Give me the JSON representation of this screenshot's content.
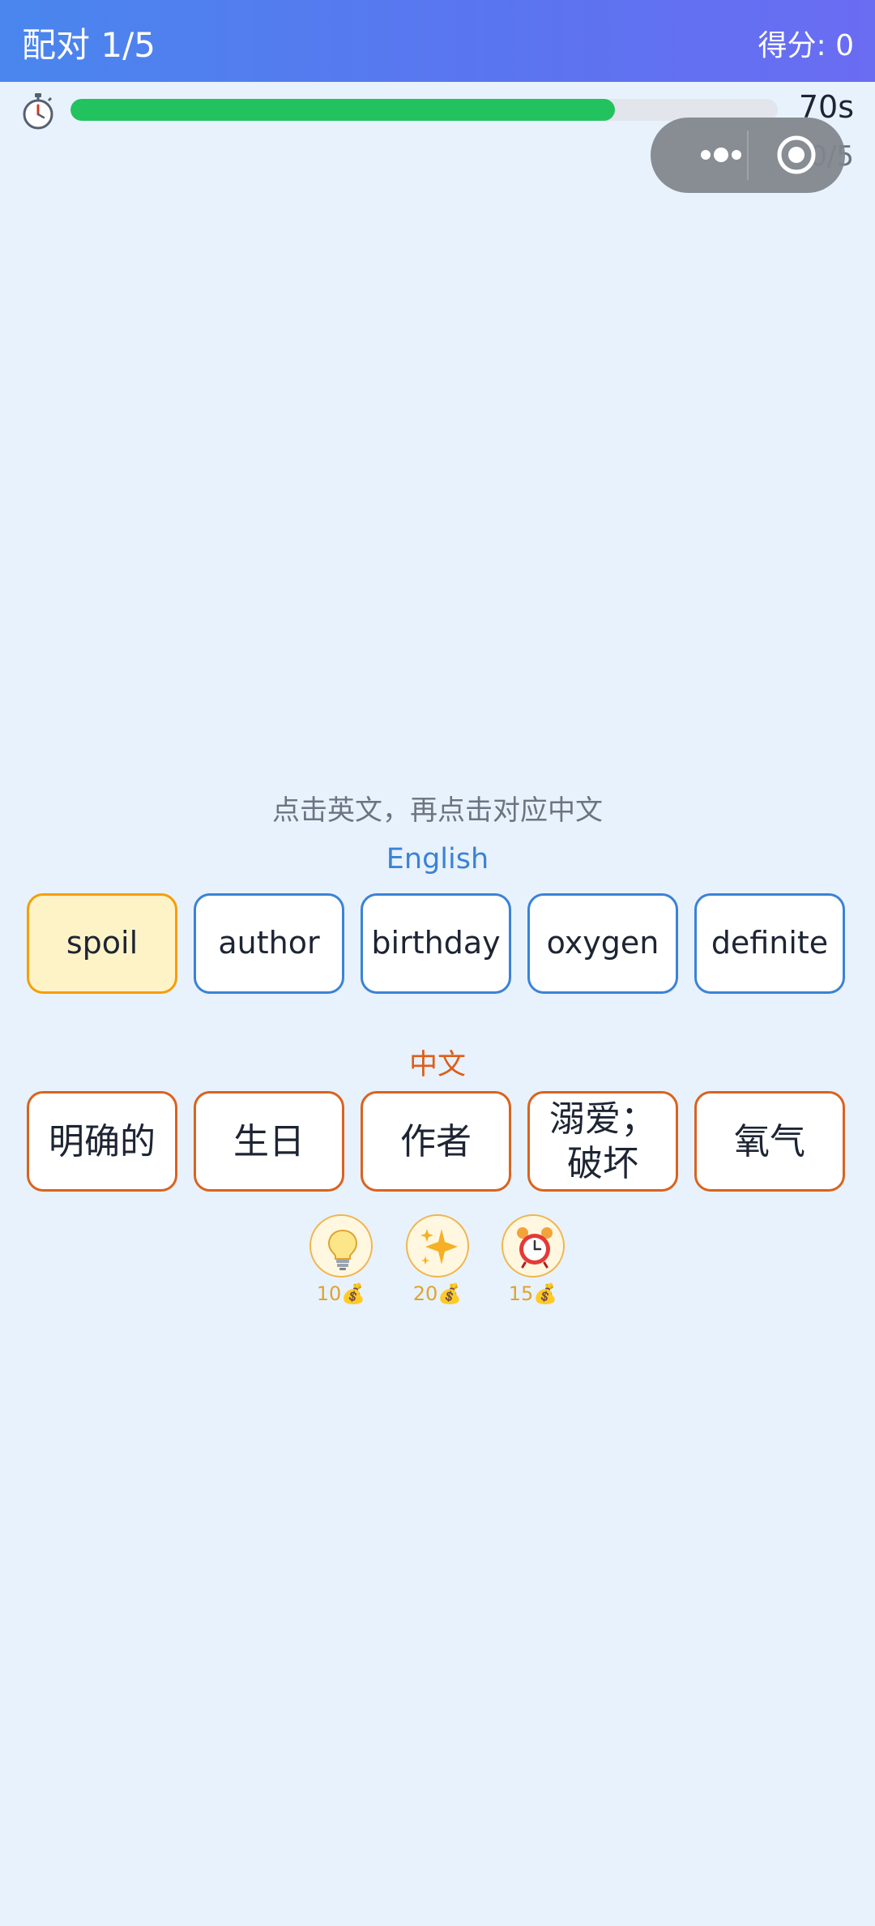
{
  "header": {
    "title": "配对 1/5",
    "score": "得分: 0"
  },
  "timer": {
    "value": "70s",
    "progress_fraction": 0.77,
    "icon": "stopwatch-icon"
  },
  "match_count": "0/5",
  "capsule": {
    "more_icon": "more-dots-icon",
    "close_icon": "close-target-icon"
  },
  "instruction": "点击英文，再点击对应中文",
  "english_label": "English",
  "chinese_label": "中文",
  "english_words": [
    {
      "text": "spoil",
      "selected": true
    },
    {
      "text": "author",
      "selected": false
    },
    {
      "text": "birthday",
      "selected": false
    },
    {
      "text": "oxygen",
      "selected": false
    },
    {
      "text": "definite",
      "selected": false
    }
  ],
  "chinese_words": [
    "明确的",
    "生日",
    "作者",
    "溺爱；破坏",
    "氧气"
  ],
  "tools": [
    {
      "icon": "lightbulb-icon",
      "cost": "10💰"
    },
    {
      "icon": "sparkle-icon",
      "cost": "20💰"
    },
    {
      "icon": "alarm-clock-icon",
      "cost": "15💰"
    }
  ],
  "colors": {
    "english_border": "#3b82d6",
    "chinese_border": "#d96320",
    "selected_bg": "#fef3c7",
    "progress": "#22c35e"
  }
}
